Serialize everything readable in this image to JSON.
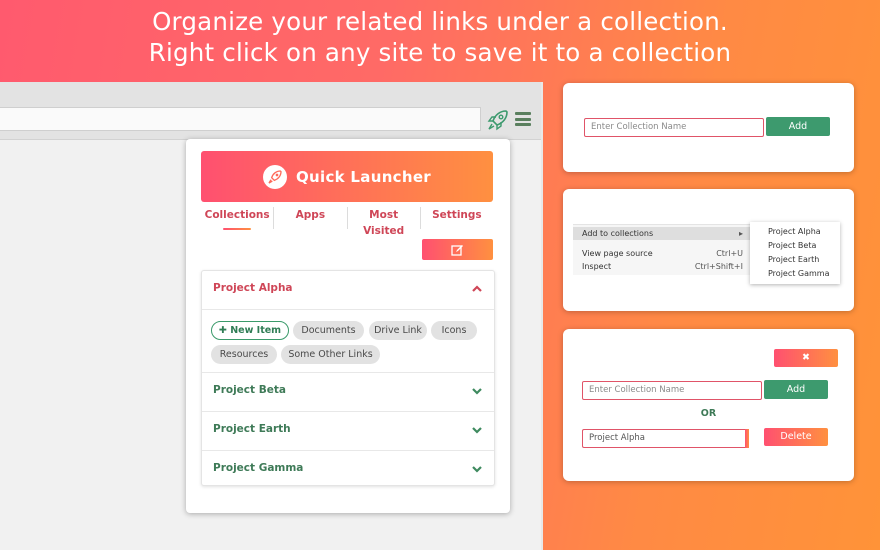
{
  "headline": {
    "line1": "Organize your related links under a collection.",
    "line2": "Right click on any site to save it to a collection"
  },
  "browser": {
    "icons": [
      "rocket-icon",
      "hamburger-menu-icon"
    ]
  },
  "popup": {
    "title": "Quick Launcher",
    "logo_icon": "rocket-icon",
    "tabs": [
      "Collections",
      "Apps",
      "Most Visited",
      "Settings"
    ],
    "active_tab": "Collections",
    "edit_icon": "edit-icon",
    "collections": [
      {
        "name": "Project Alpha",
        "expanded": true
      },
      {
        "name": "Project Beta",
        "expanded": false
      },
      {
        "name": "Project Earth",
        "expanded": false
      },
      {
        "name": "Project Gamma",
        "expanded": false
      }
    ],
    "new_item_label": "New Item",
    "new_item_icon": "plus-icon",
    "chips": [
      "Documents",
      "Drive Link",
      "Icons",
      "Resources",
      "Some Other Links"
    ]
  },
  "card1": {
    "placeholder": "Enter Collection Name",
    "add_label": "Add"
  },
  "card2": {
    "menu": [
      {
        "label": "Add to collections",
        "shortcut": "",
        "has_submenu": true
      },
      {
        "label": "View page source",
        "shortcut": "Ctrl+U"
      },
      {
        "label": "Inspect",
        "shortcut": "Ctrl+Shift+I"
      }
    ],
    "submenu": [
      "Project Alpha",
      "Project Beta",
      "Project Earth",
      "Project Gamma"
    ]
  },
  "card3": {
    "close_icon": "close-icon",
    "placeholder": "Enter Collection Name",
    "add_label": "Add",
    "or_label": "OR",
    "select_value": "Project Alpha",
    "delete_label": "Delete"
  },
  "colors": {
    "accent_red": "#e05468",
    "accent_orange": "#ff9040",
    "green": "#3d9a6e"
  }
}
